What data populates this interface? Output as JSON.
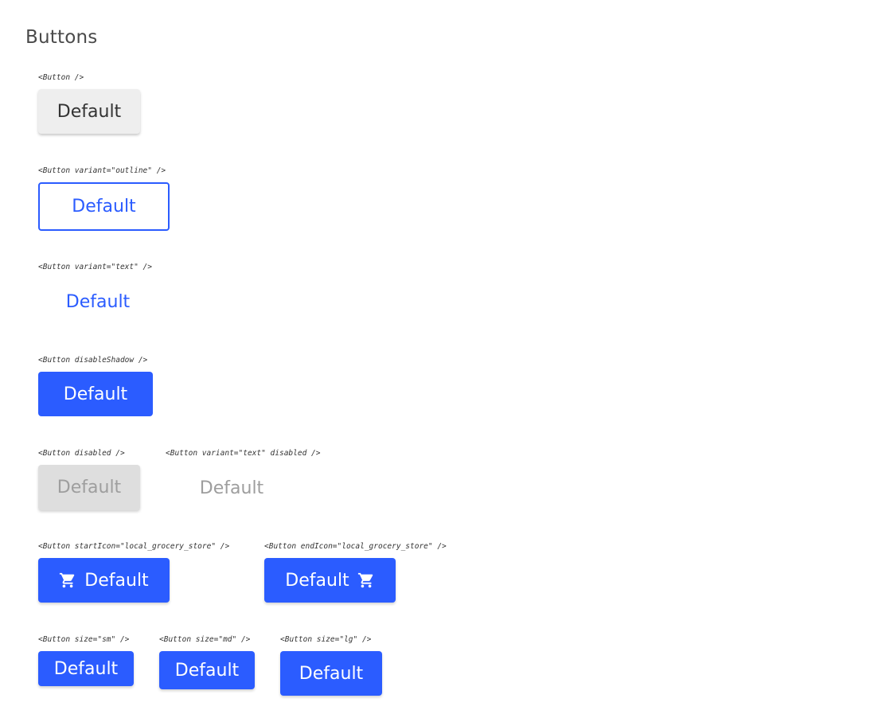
{
  "title": "Buttons",
  "sections": {
    "default": {
      "caption": "<Button />",
      "label": "Default"
    },
    "outline": {
      "caption": "<Button variant=\"outline\" />",
      "label": "Default"
    },
    "text": {
      "caption": "<Button variant=\"text\" />",
      "label": "Default"
    },
    "disable_shadow": {
      "caption": "<Button disableShadow />",
      "label": "Default"
    },
    "disabled": {
      "caption": "<Button disabled />",
      "label": "Default"
    },
    "text_disabled": {
      "caption": "<Button variant=\"text\" disabled />",
      "label": "Default"
    },
    "start_icon": {
      "caption": "<Button startIcon=\"local_grocery_store\" />",
      "label": "Default",
      "icon": "cart-icon"
    },
    "end_icon": {
      "caption": "<Button endIcon=\"local_grocery_store\" />",
      "label": "Default",
      "icon": "cart-icon"
    },
    "size_sm": {
      "caption": "<Button size=\"sm\" />",
      "label": "Default"
    },
    "size_md": {
      "caption": "<Button size=\"md\" />",
      "label": "Default"
    },
    "size_lg": {
      "caption": "<Button size=\"lg\" />",
      "label": "Default"
    }
  },
  "colors": {
    "primary": "#2b5cff",
    "default_bg": "#eeeeee",
    "disabled_bg": "#dedede",
    "disabled_text": "#9e9e9e"
  }
}
